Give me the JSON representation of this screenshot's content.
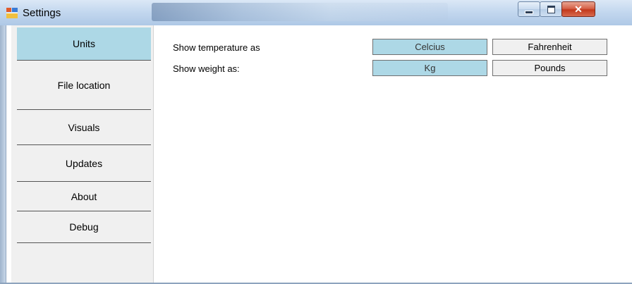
{
  "window": {
    "title": "Settings"
  },
  "sidebar": {
    "tabs": [
      {
        "label": "Units",
        "active": true
      },
      {
        "label": "File location",
        "active": false
      },
      {
        "label": "Visuals",
        "active": false
      },
      {
        "label": "Updates",
        "active": false
      },
      {
        "label": "About",
        "active": false
      },
      {
        "label": "Debug",
        "active": false
      }
    ]
  },
  "units": {
    "temperature": {
      "label": "Show temperature as",
      "options": [
        "Celcius",
        "Fahrenheit"
      ],
      "selected": "Celcius"
    },
    "weight": {
      "label": "Show weight as:",
      "options": [
        "Kg",
        "Pounds"
      ],
      "selected": "Kg"
    }
  },
  "colors": {
    "selected_bg": "#add8e6",
    "unselected_bg": "#f0f0f0"
  }
}
